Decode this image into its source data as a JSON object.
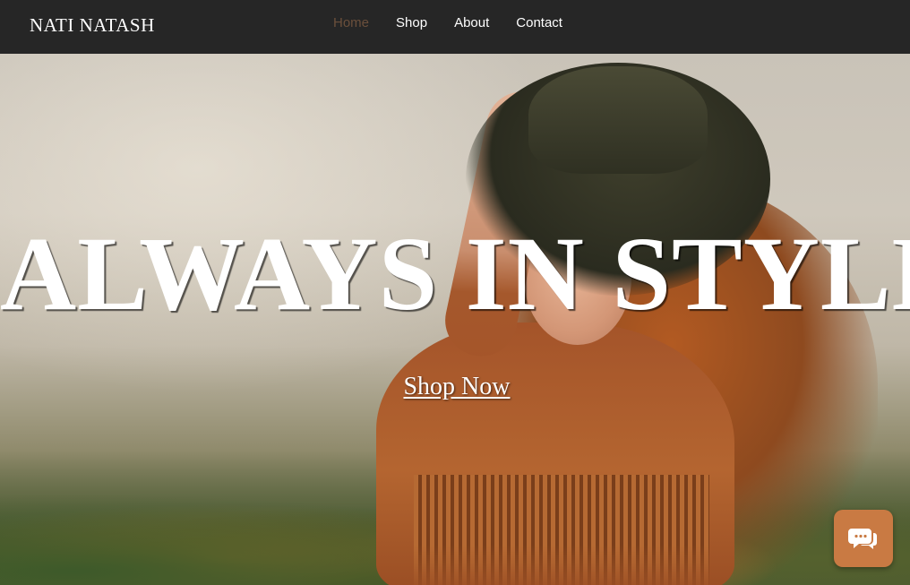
{
  "site": {
    "logo": "NATI NATASH"
  },
  "nav": {
    "items": [
      {
        "label": "Home",
        "active": true
      },
      {
        "label": "Shop",
        "active": false
      },
      {
        "label": "About",
        "active": false
      },
      {
        "label": "Contact",
        "active": false
      }
    ]
  },
  "hero": {
    "headline": "ALWAYS IN STYLE",
    "cta_label": "Shop Now"
  },
  "chat": {
    "icon": "chat-bubbles-icon"
  },
  "colors": {
    "header_bg": "#262626",
    "active_nav": "#6b4f3b",
    "chat_button": "#c97a43",
    "text": "#ffffff"
  }
}
